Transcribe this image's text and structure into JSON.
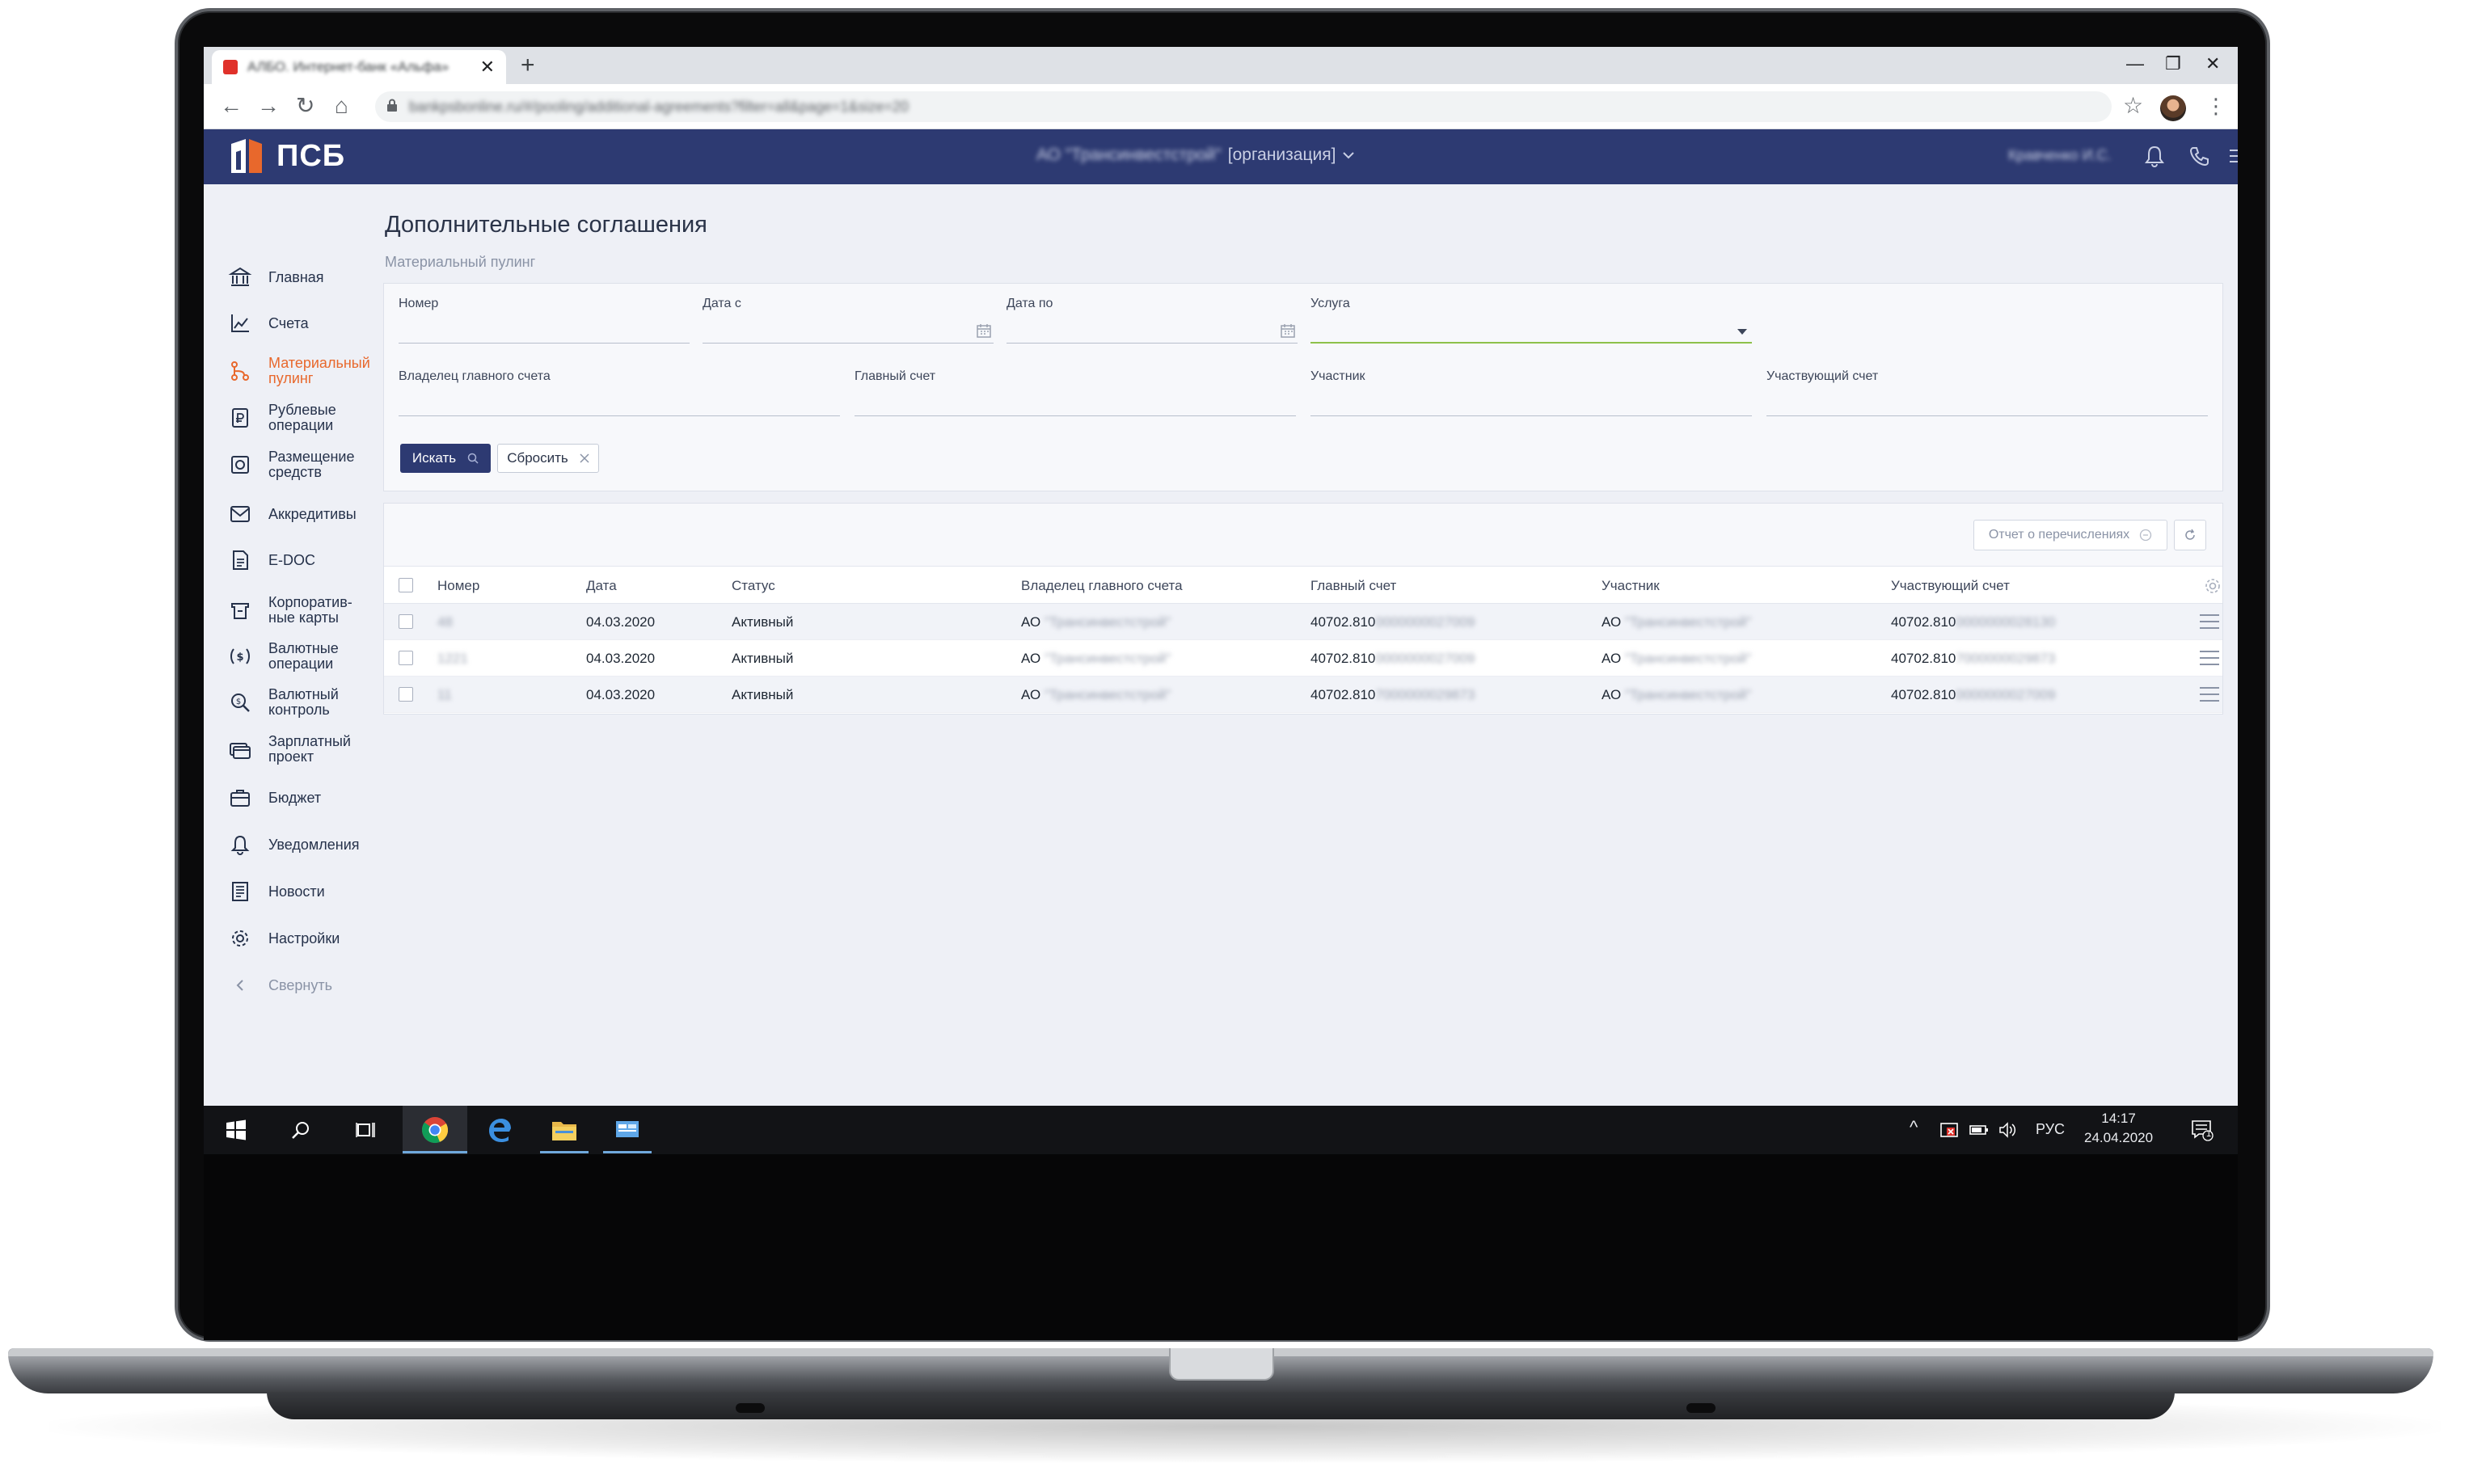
{
  "browser": {
    "tab_title": "АЛБО. Интернет-банк «Альфа»",
    "tab_close": "✕",
    "new_tab": "+",
    "window_controls": {
      "minimize": "—",
      "maximize": "❐",
      "close": "✕"
    },
    "url": "bankpsbonline.ru/#/pooling/additional-agreements?filter=all&page=1&size=20",
    "back": "←",
    "forward": "→",
    "reload": "↻",
    "home": "⌂",
    "lock": "🔒",
    "star": "☆",
    "kebab": "⋮"
  },
  "header": {
    "logo_text": "ПСБ",
    "org_name": "АО \"Трансинвестстрой\"",
    "org_suffix": "[организация]",
    "user_name": "Кравченко И.С.",
    "colors": {
      "appbar": "#2d3a72",
      "accent": "#e8682c",
      "active_field": "#8dc14a"
    }
  },
  "sidebar": {
    "items": [
      {
        "label": "Главная",
        "icon": "bank-icon"
      },
      {
        "label": "Счета",
        "icon": "chart-icon"
      },
      {
        "label": "Материальный\nпулинг",
        "icon": "pooling-icon",
        "active": true
      },
      {
        "label": "Рублевые\nоперации",
        "icon": "ruble-doc-icon"
      },
      {
        "label": "Размещение\nсредств",
        "icon": "deposit-icon"
      },
      {
        "label": "Аккредитивы",
        "icon": "letter-of-credit-icon"
      },
      {
        "label": "E-DOC",
        "icon": "edoc-icon"
      },
      {
        "label": "Корпоратив-\nные карты",
        "icon": "card-icon"
      },
      {
        "label": "Валютные\nоперации",
        "icon": "currency-icon"
      },
      {
        "label": "Валютный\nконтроль",
        "icon": "currency-control-icon"
      },
      {
        "label": "Зарплатный\nпроект",
        "icon": "salary-icon"
      },
      {
        "label": "Бюджет",
        "icon": "budget-icon"
      },
      {
        "label": "Уведомления",
        "icon": "bell-icon"
      },
      {
        "label": "Новости",
        "icon": "news-icon"
      },
      {
        "label": "Настройки",
        "icon": "gear-icon"
      },
      {
        "label": "Свернуть",
        "icon": "chevron-left-icon",
        "muted": true
      }
    ]
  },
  "page": {
    "title": "Дополнительные соглашения",
    "breadcrumb": "Материальный пулинг"
  },
  "filters": {
    "number": {
      "label": "Номер",
      "value": ""
    },
    "date_from": {
      "label": "Дата с",
      "value": ""
    },
    "date_to": {
      "label": "Дата по",
      "value": ""
    },
    "service": {
      "label": "Услуга",
      "value": ""
    },
    "main_owner": {
      "label": "Владелец главного счета",
      "value": ""
    },
    "main_account": {
      "label": "Главный счет",
      "value": ""
    },
    "participant": {
      "label": "Участник",
      "value": ""
    },
    "participant_account": {
      "label": "Участвующий счет",
      "value": ""
    },
    "search_button": "Искать",
    "reset_button": "Сбросить"
  },
  "table": {
    "report_button": "Отчет о перечислениях",
    "columns": [
      "Номер",
      "Дата",
      "Статус",
      "Владелец главного счета",
      "Главный счет",
      "Участник",
      "Участвующий счет"
    ],
    "rows": [
      {
        "number": "48",
        "date": "04.03.2020",
        "status": "Активный",
        "owner_prefix": "АО",
        "owner_hidden": "\"Трансинвестстрой\"",
        "main_acc": "40702.810",
        "main_acc_hidden": "0000000027009",
        "participant_prefix": "АО",
        "participant_hidden": "\"Трансинвестстрой\"",
        "part_acc": "40702.810",
        "part_acc_hidden": "0000000028130"
      },
      {
        "number": "1221",
        "date": "04.03.2020",
        "status": "Активный",
        "owner_prefix": "АО",
        "owner_hidden": "\"Трансинвестстрой\"",
        "main_acc": "40702.810",
        "main_acc_hidden": "0000000027009",
        "participant_prefix": "АО",
        "participant_hidden": "\"Трансинвестстрой\"",
        "part_acc": "40702.810",
        "part_acc_hidden": "7000000029873"
      },
      {
        "number": "11",
        "date": "04.03.2020",
        "status": "Активный",
        "owner_prefix": "АО",
        "owner_hidden": "\"Трансинвестстрой\"",
        "main_acc": "40702.810",
        "main_acc_hidden": "7000000029873",
        "participant_prefix": "АО",
        "participant_hidden": "\"Трансинвестстрой\"",
        "part_acc": "40702.810",
        "part_acc_hidden": "0000000027009"
      }
    ]
  },
  "taskbar": {
    "tray_lang": "РУС",
    "time": "14:17",
    "date": "24.04.2020",
    "notification_count": "1",
    "tray_up": "^"
  }
}
